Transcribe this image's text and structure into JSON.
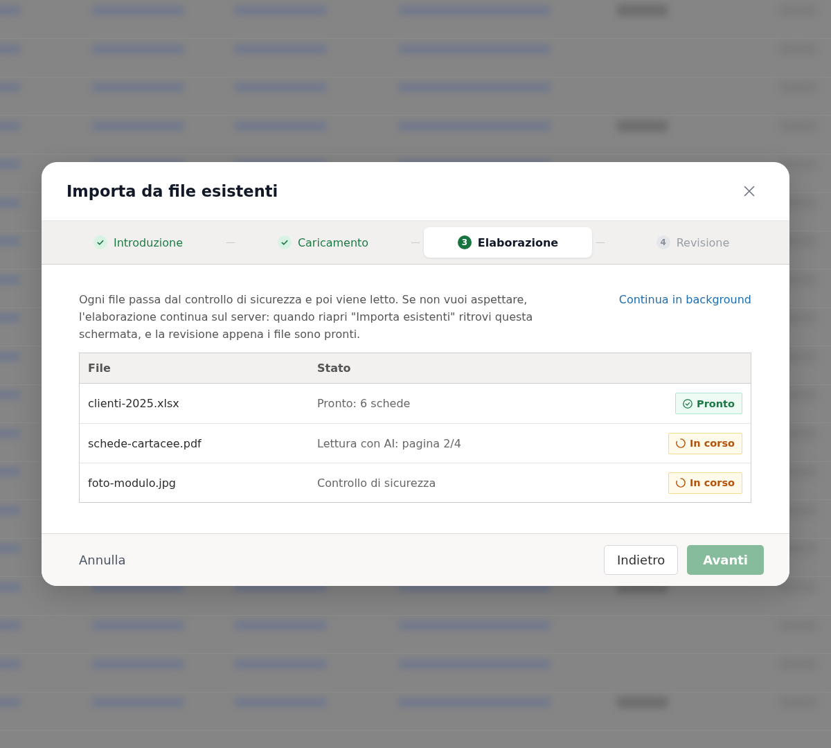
{
  "dialog": {
    "title": "Importa da file esistenti"
  },
  "steps": [
    {
      "label": "Introduzione",
      "done": true,
      "selected": false
    },
    {
      "label": "Caricamento",
      "done": true,
      "selected": false
    },
    {
      "number": "3",
      "label": "Elaborazione",
      "done": false,
      "selected": true
    },
    {
      "number": "4",
      "label": "Revisione",
      "done": false,
      "selected": false
    }
  ],
  "intro": {
    "text": "Ogni file passa dal controllo di sicurezza e poi viene letto. Se non vuoi aspettare, l'elaborazione continua sul server: quando riapri \"Importa esistenti\" ritrovi questa schermata, e la revisione appena i file sono pronti.",
    "link": "Continua in background"
  },
  "table": {
    "columns": [
      "File",
      "Stato"
    ],
    "rows": [
      {
        "file": "clienti-2025.xlsx",
        "detail": "Pronto: 6 schede",
        "badge": {
          "label": "Pronto",
          "kind": "ready"
        }
      },
      {
        "file": "schede-cartacee.pdf",
        "detail": "Lettura con AI: pagina 2/4",
        "badge": {
          "label": "In corso",
          "kind": "progress"
        }
      },
      {
        "file": "foto-modulo.jpg",
        "detail": "Controllo di sicurezza",
        "badge": {
          "label": "In corso",
          "kind": "progress"
        }
      }
    ]
  },
  "footer": {
    "cancel": "Annulla",
    "buttons": [
      {
        "label": "Indietro",
        "kind": "secondary",
        "disabled": false
      },
      {
        "label": "Avanti",
        "kind": "primary",
        "disabled": true
      }
    ]
  }
}
